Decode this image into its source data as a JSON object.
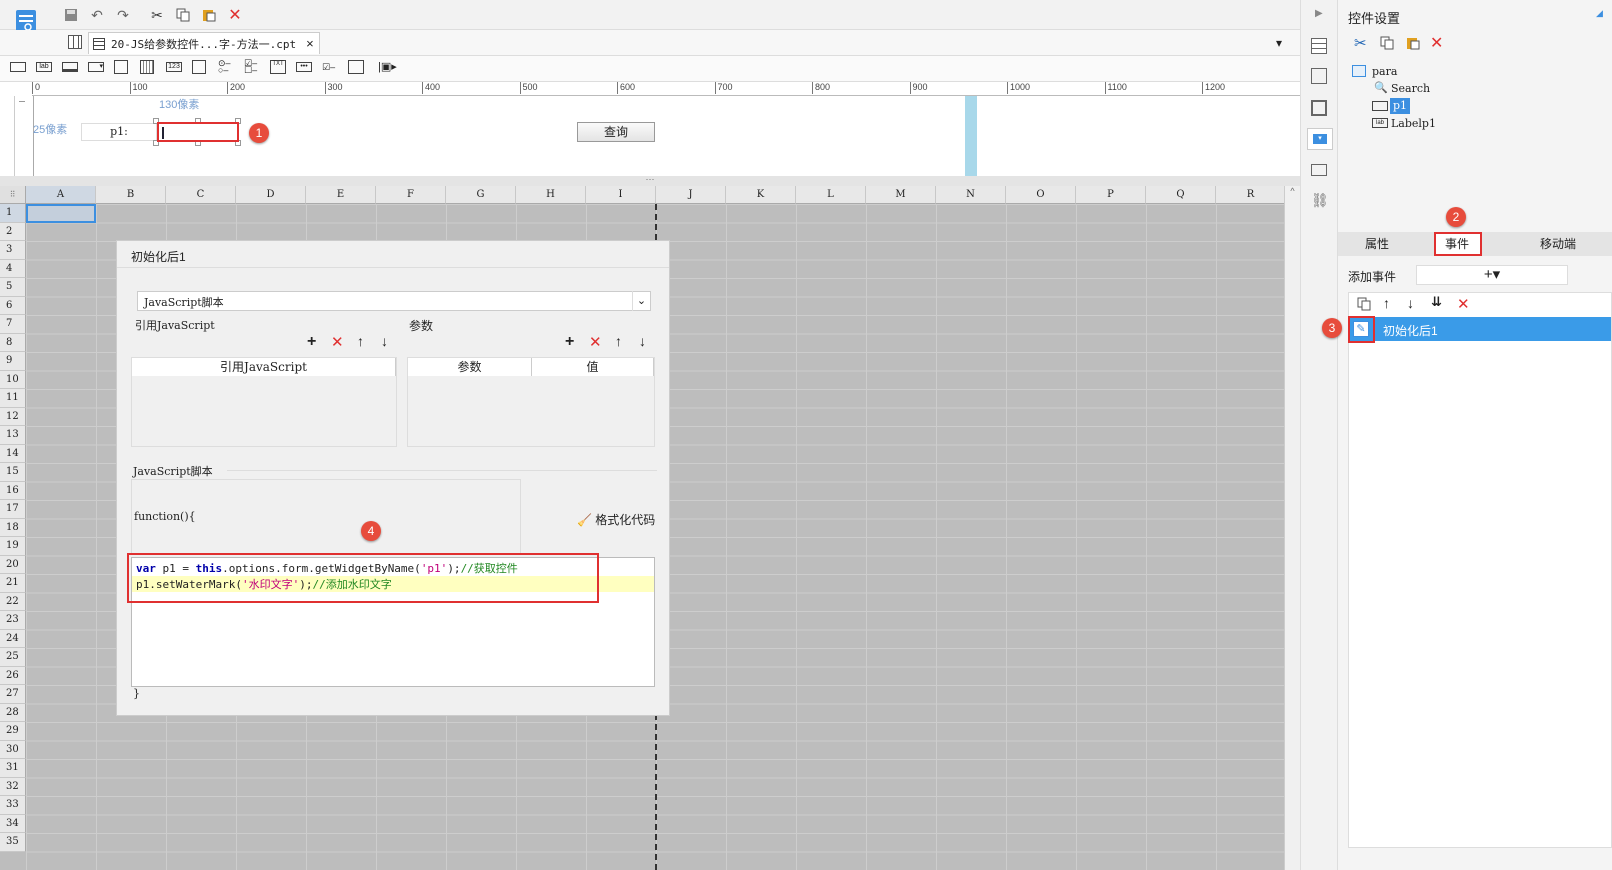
{
  "tab": {
    "title": "20-JS给参数控件...字-方法一.cpt",
    "close": "×"
  },
  "ruler": {
    "ticks": [
      "0",
      "100",
      "200",
      "300",
      "400",
      "500",
      "600",
      "700",
      "800",
      "900",
      "1000",
      "1100",
      "1200"
    ]
  },
  "param": {
    "dim_width": "130像素",
    "dim_height": "25像素",
    "label_p1": "p1:",
    "query_button": "查询"
  },
  "grid": {
    "columns": [
      "A",
      "B",
      "C",
      "D",
      "E",
      "F",
      "G",
      "H",
      "I",
      "J",
      "K",
      "L",
      "M",
      "N",
      "O",
      "P",
      "Q",
      "R"
    ],
    "rows": [
      "1",
      "2",
      "3",
      "4",
      "5",
      "6",
      "7",
      "8",
      "9",
      "10",
      "11",
      "12",
      "13",
      "14",
      "15",
      "16",
      "17",
      "18",
      "19",
      "20",
      "21",
      "22",
      "23",
      "24",
      "25",
      "26",
      "27",
      "28",
      "29",
      "30",
      "31",
      "32",
      "33",
      "34",
      "35"
    ]
  },
  "dialog": {
    "title": "初始化后1",
    "type_select": "JavaScript脚本",
    "ref_js_label": "引用JavaScript",
    "param_label": "参数",
    "ref_js_header": "引用JavaScript",
    "param_header": "参数",
    "value_header": "值",
    "script_label": "JavaScript脚本",
    "func_open": "function(){",
    "format_code": "格式化代码",
    "code_line1": {
      "kw1": "var",
      "t1": " p1 = ",
      "kw2": "this",
      "t2": ".options.form.getWidgetByName(",
      "str": "'p1'",
      "t3": ");",
      "comment": "//获取控件"
    },
    "code_line2": {
      "t1": "p1.setWaterMark(",
      "str": "'水印文字'",
      "t2": ");",
      "comment": "//添加水印文字"
    },
    "func_close": "}"
  },
  "right": {
    "title": "控件设置",
    "tree_root": "para",
    "tree_items": [
      "Search",
      "p1",
      "Labelp1"
    ],
    "tabs": {
      "props": "属性",
      "events": "事件",
      "mobile": "移动端"
    },
    "add_event": "添加事件",
    "add_symbol": "+▾",
    "event_item": "初始化后1"
  },
  "badges": [
    "1",
    "2",
    "3",
    "4"
  ],
  "colors": {
    "accent": "#3c8fe0",
    "selection": "#3a9be8",
    "red": "#e03030",
    "highlight": "#ffffc0"
  }
}
